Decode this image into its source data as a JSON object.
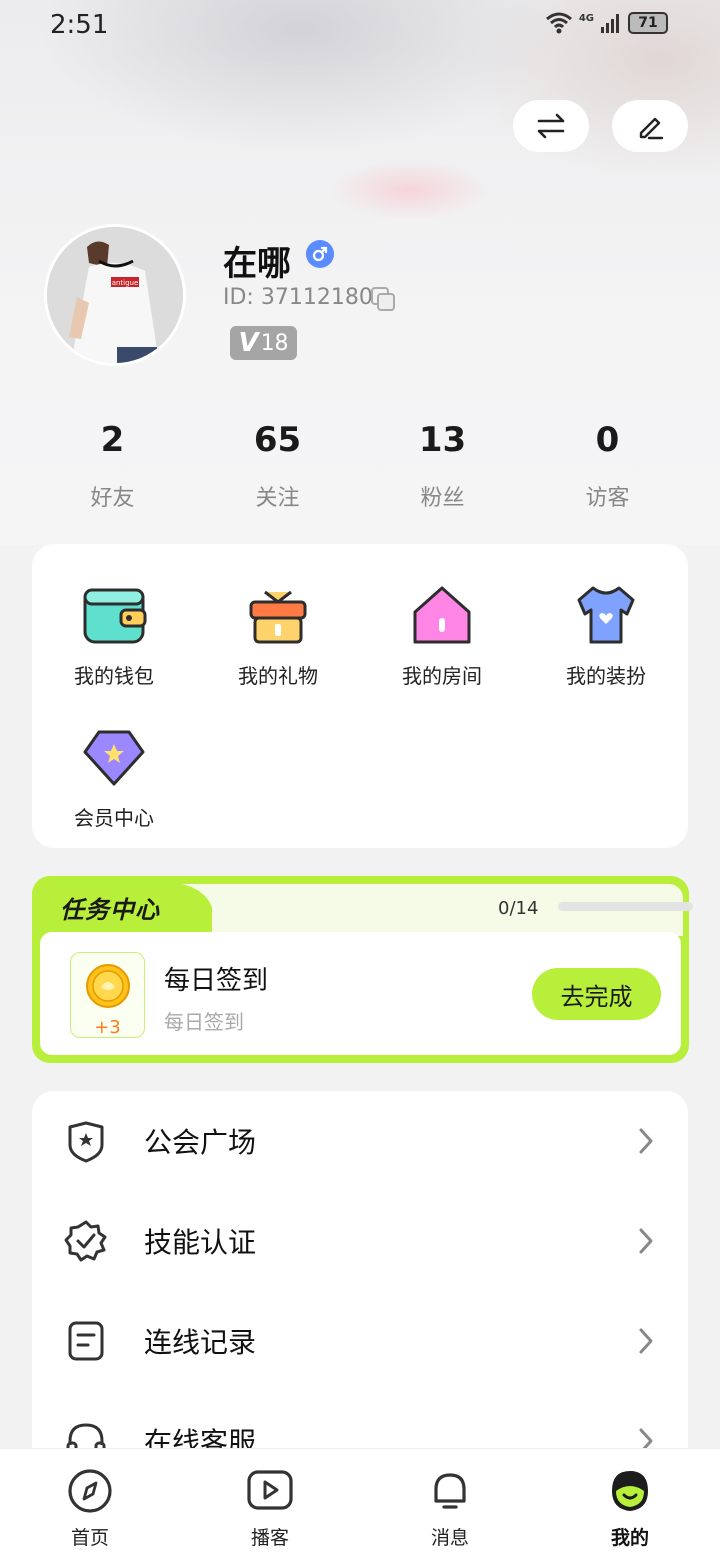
{
  "status_bar": {
    "time": "2:51",
    "network": "4G",
    "battery": "71"
  },
  "profile": {
    "name": "在哪",
    "id_text": "ID: 37112180",
    "vip_level": "18",
    "gender": "male",
    "avatar_text": "antigue"
  },
  "stats": [
    {
      "value": "2",
      "label": "好友"
    },
    {
      "value": "65",
      "label": "关注"
    },
    {
      "value": "13",
      "label": "粉丝"
    },
    {
      "value": "0",
      "label": "访客"
    }
  ],
  "grid": [
    {
      "label": "我的钱包",
      "icon": "wallet-icon",
      "color": "#5fe0cf"
    },
    {
      "label": "我的礼物",
      "icon": "gift-icon",
      "color": "#ff9a55"
    },
    {
      "label": "我的房间",
      "icon": "house-icon",
      "color": "#ff86e5"
    },
    {
      "label": "我的装扮",
      "icon": "tshirt-icon",
      "color": "#7fa2ff"
    },
    {
      "label": "会员中心",
      "icon": "vip-gem-icon",
      "color": "#9b87ff"
    }
  ],
  "task": {
    "title": "任务中心",
    "progress_text": "0/14",
    "progress": 0,
    "name": "每日签到",
    "desc": "每日签到",
    "reward": "+3",
    "button": "去完成",
    "accent": "#b8ef3a"
  },
  "list": [
    {
      "label": "公会广场",
      "icon": "shield-icon"
    },
    {
      "label": "技能认证",
      "icon": "verified-badge-icon"
    },
    {
      "label": "连线记录",
      "icon": "record-icon"
    },
    {
      "label": "在线客服",
      "icon": "headset-icon"
    }
  ],
  "nav": [
    {
      "label": "首页",
      "icon": "compass-icon"
    },
    {
      "label": "播客",
      "icon": "play-icon"
    },
    {
      "label": "消息",
      "icon": "bell-icon"
    },
    {
      "label": "我的",
      "icon": "mine-avatar-icon",
      "active": true
    }
  ]
}
